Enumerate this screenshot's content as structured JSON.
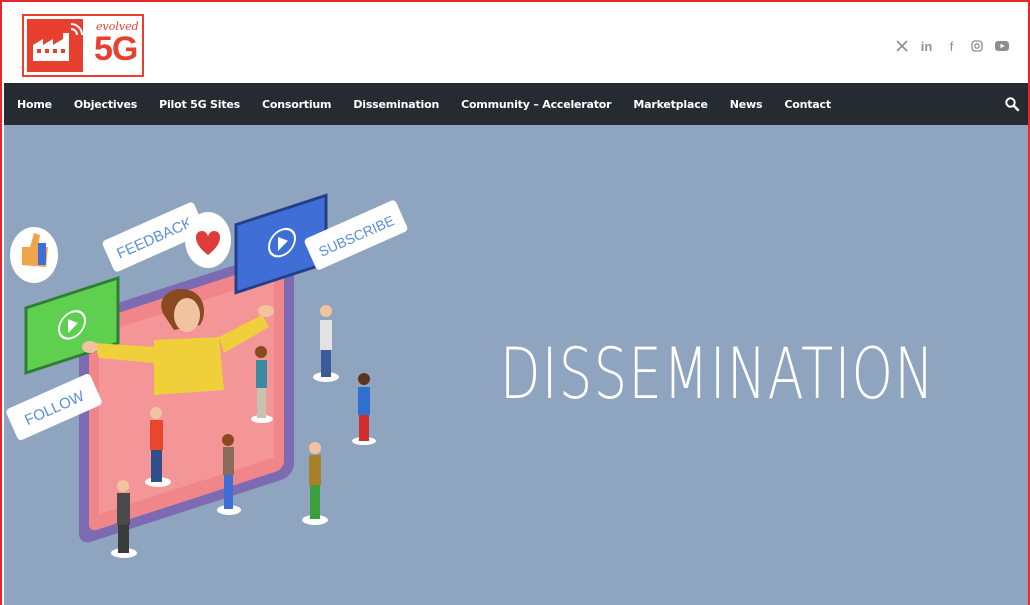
{
  "brand": {
    "logo_small_text": "evolved",
    "logo_big_text": "5G",
    "logo_color": "#e8402f"
  },
  "social": [
    {
      "icon": "x-icon"
    },
    {
      "icon": "linkedin-icon",
      "glyph": "in"
    },
    {
      "icon": "facebook-icon",
      "glyph": "f"
    },
    {
      "icon": "instagram-icon"
    },
    {
      "icon": "youtube-icon"
    }
  ],
  "nav": {
    "items": [
      "Home",
      "Objectives",
      "Pilot 5G Sites",
      "Consortium",
      "Dissemination",
      "Community – Accelerator",
      "Marketplace",
      "News",
      "Contact"
    ],
    "background": "#262a31"
  },
  "hero": {
    "title": "DISSEMINATION",
    "background": "#8fa5bf",
    "bubbles": {
      "feedback": "FEEDBACK",
      "subscribe": "SUBSCRIBE",
      "follow": "FOLLOW"
    }
  }
}
